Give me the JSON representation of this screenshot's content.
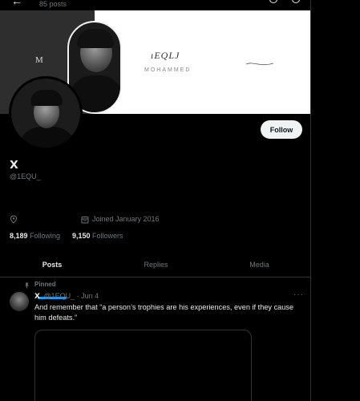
{
  "header": {
    "post_count": "85 posts"
  },
  "banner": {
    "monogram": "M",
    "brand": "ıEQLJ",
    "subtitle": "MOHAMMED"
  },
  "profile": {
    "display_name": "𝗫",
    "handle": "@1EQU_",
    "follow_label": "Follow",
    "joined": "Joined January 2016",
    "following_count": "8,189",
    "following_label": "Following",
    "followers_count": "9,150",
    "followers_label": "Followers"
  },
  "tabs": [
    {
      "label": "Posts",
      "active": true
    },
    {
      "label": "Replies",
      "active": false
    },
    {
      "label": "Media",
      "active": false
    }
  ],
  "pinned_tweet": {
    "pinned_label": "Pinned",
    "author_name": "𝗫",
    "author_handle": "@1EQU_",
    "date": "· Jun 4",
    "text": "And remember that “a person’s trophies are his experiences, even if they cause him defeats.”"
  },
  "colors": {
    "background": "#000000",
    "accent": "#1d9bf0",
    "muted": "#71767b",
    "text": "#e7e9ea"
  }
}
